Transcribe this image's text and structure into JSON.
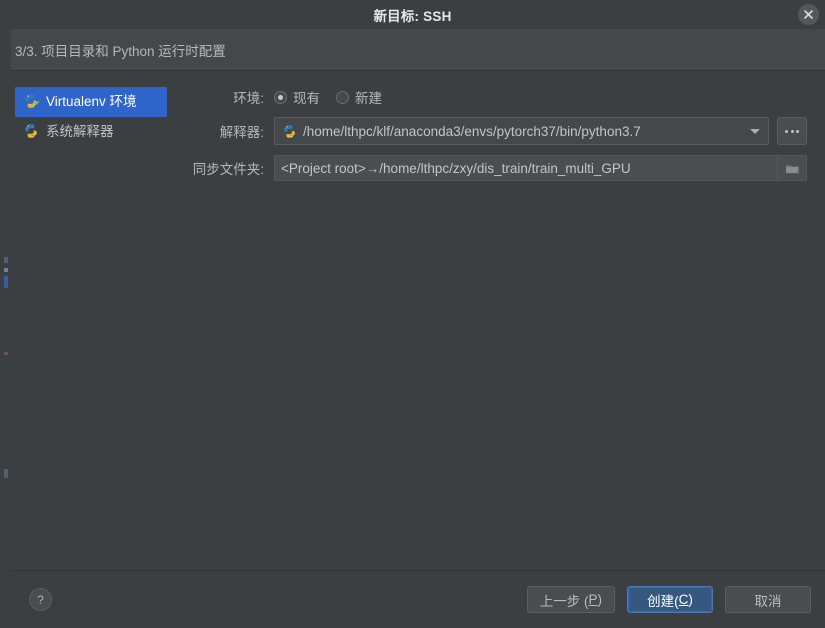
{
  "window": {
    "title": "新目标: SSH",
    "close_icon": "close-icon",
    "subtitle": "3/3. 项目目录和 Python 运行时配置"
  },
  "sidebar": {
    "items": [
      {
        "label": "Virtualenv 环境",
        "icon": "python-virtualenv-icon",
        "selected": true
      },
      {
        "label": "系统解释器",
        "icon": "python-icon",
        "selected": false
      }
    ]
  },
  "form": {
    "environment": {
      "label": "环境:",
      "options": [
        {
          "label": "现有",
          "checked": true
        },
        {
          "label": "新建",
          "checked": false
        }
      ]
    },
    "interpreter": {
      "label": "解释器:",
      "value": "/home/lthpc/klf/anaconda3/envs/pytorch37/bin/python3.7",
      "icon": "python-icon",
      "dropdown_icon": "chevron-down-icon",
      "browse_label": "...",
      "browse_icon": "ellipsis-icon"
    },
    "sync_folder": {
      "label": "同步文件夹:",
      "value": "<Project root>→/home/lthpc/zxy/dis_train/train_multi_GPU",
      "browse_icon": "folder-icon"
    }
  },
  "footer": {
    "help_label": "?",
    "help_icon": "help-icon",
    "buttons": [
      {
        "name": "back-button",
        "text_before": "上一步 (",
        "mnemonic": "P",
        "text_after": ")",
        "primary": false
      },
      {
        "name": "create-button",
        "text_before": "创建(",
        "mnemonic": "C",
        "text_after": ")",
        "primary": true
      },
      {
        "name": "cancel-button",
        "text_before": "取消",
        "mnemonic": "",
        "text_after": "",
        "primary": false
      }
    ]
  },
  "colors": {
    "accent": "#2f65ca",
    "primary_button": "#365880",
    "dialog_bg": "#3c3f41",
    "header_bg": "#45484a",
    "field_bg": "#45484a",
    "text": "#b6b8ba"
  }
}
